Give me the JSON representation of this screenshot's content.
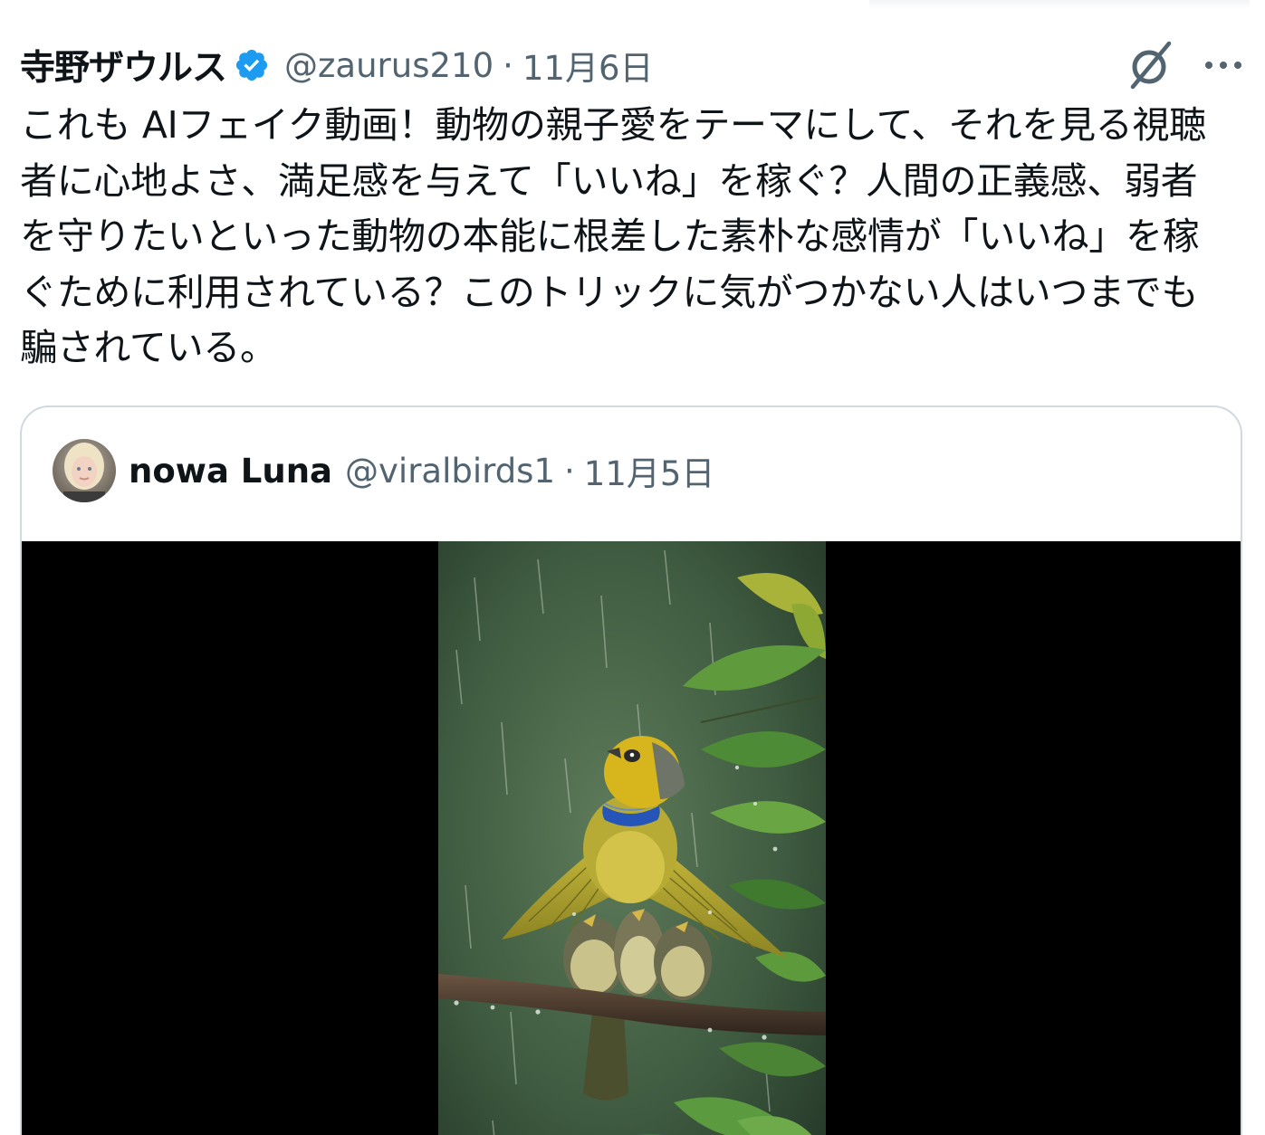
{
  "tweet": {
    "author_name": "寺野ザウルス",
    "handle": "@zaurus210",
    "separator": "·",
    "date": "11月6日",
    "text": "これも AIフェイク動画！動物の親子愛をテーマにして、それを見る視聴者に心地よさ、満足感を与えて「いいね」を稼ぐ？人間の正義感、弱者を守りたいといった動物の本能に根差した素朴な感情が「いいね」を稼ぐために利用されている？このトリックに気がつかない人はいつまでも騙されている。",
    "verified": true
  },
  "icons": {
    "verified": "verified-badge-icon",
    "grok": "grok-icon",
    "more": "more-options-icon"
  },
  "quote": {
    "author_name": "nowa Luna",
    "handle": "@viralbirds1",
    "separator": "·",
    "date": "11月5日",
    "media": "video-still-yellow-bird-sheltering-chicks-in-rain"
  },
  "colors": {
    "text": "#0f1419",
    "secondary": "#536471",
    "verified_blue": "#1d9bf0",
    "border": "#cfd9de",
    "media_background": "#000000"
  }
}
